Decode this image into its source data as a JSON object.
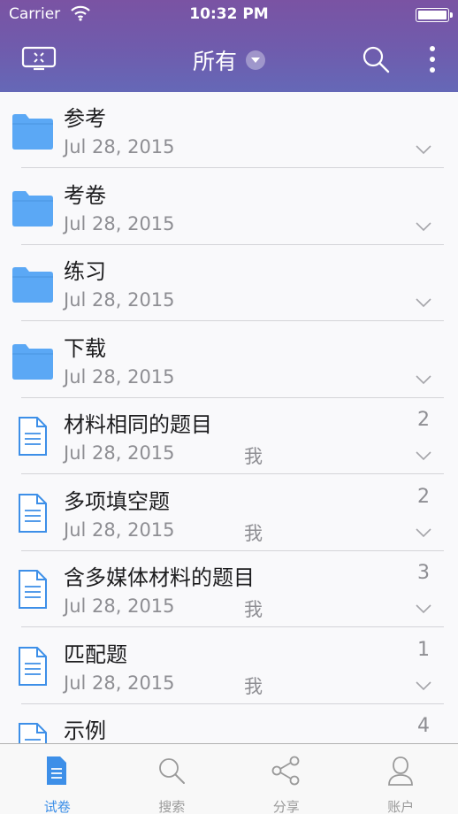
{
  "status_bar": {
    "carrier": "Carrier",
    "time": "10:32 PM"
  },
  "nav": {
    "left_icon": "screen-cast-icon",
    "title": "所有",
    "dropdown_icon": "chevron-down-circle-icon",
    "search_icon": "search-icon",
    "more_icon": "more-vertical-icon"
  },
  "items": [
    {
      "type": "folder",
      "title": "参考",
      "date": "Jul 28, 2015",
      "owner": "",
      "count": ""
    },
    {
      "type": "folder",
      "title": "考卷",
      "date": "Jul 28, 2015",
      "owner": "",
      "count": ""
    },
    {
      "type": "folder",
      "title": "练习",
      "date": "Jul 28, 2015",
      "owner": "",
      "count": ""
    },
    {
      "type": "folder",
      "title": "下载",
      "date": "Jul 28, 2015",
      "owner": "",
      "count": ""
    },
    {
      "type": "document",
      "title": "材料相同的题目",
      "date": "Jul 28, 2015",
      "owner": "我",
      "count": "2"
    },
    {
      "type": "document",
      "title": "多项填空题",
      "date": "Jul 28, 2015",
      "owner": "我",
      "count": "2"
    },
    {
      "type": "document",
      "title": "含多媒体材料的题目",
      "date": "Jul 28, 2015",
      "owner": "我",
      "count": "3"
    },
    {
      "type": "document",
      "title": "匹配题",
      "date": "Jul 28, 2015",
      "owner": "我",
      "count": "1"
    },
    {
      "type": "document",
      "title": "示例",
      "date": "",
      "owner": "",
      "count": "4"
    }
  ],
  "tabs": [
    {
      "label": "试卷",
      "icon": "document-icon",
      "active": true
    },
    {
      "label": "搜索",
      "icon": "search-icon",
      "active": false
    },
    {
      "label": "分享",
      "icon": "share-icon",
      "active": false
    },
    {
      "label": "账户",
      "icon": "account-icon",
      "active": false
    }
  ],
  "colors": {
    "header_top": "#7a53a3",
    "header_bottom": "#6568b7",
    "accent": "#3d8fe8",
    "folder": "#5ba8f5"
  }
}
